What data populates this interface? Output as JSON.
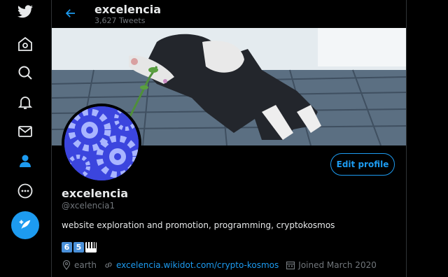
{
  "nav": {
    "items": [
      {
        "icon": "twitter-bird-icon"
      },
      {
        "icon": "home-icon"
      },
      {
        "icon": "explore-icon"
      },
      {
        "icon": "notifications-bell-icon"
      },
      {
        "icon": "messages-envelope-icon"
      },
      {
        "icon": "profile-person-icon"
      },
      {
        "icon": "more-icon"
      }
    ],
    "compose_icon": "compose-tweet-icon",
    "accent_color": "#1d9bf0"
  },
  "header": {
    "title": "excelencia",
    "tweet_count": "3,627 Tweets"
  },
  "profile": {
    "edit_label": "Edit profile",
    "name": "excelencia",
    "handle": "@xcelencia1",
    "bio": "website exploration and promotion, programming, cryptokosmos",
    "emoji": [
      "6",
      "5"
    ],
    "location": "earth",
    "website": "excelencia.wikidot.com/crypto-kosmos",
    "joined": "Joined March 2020"
  }
}
